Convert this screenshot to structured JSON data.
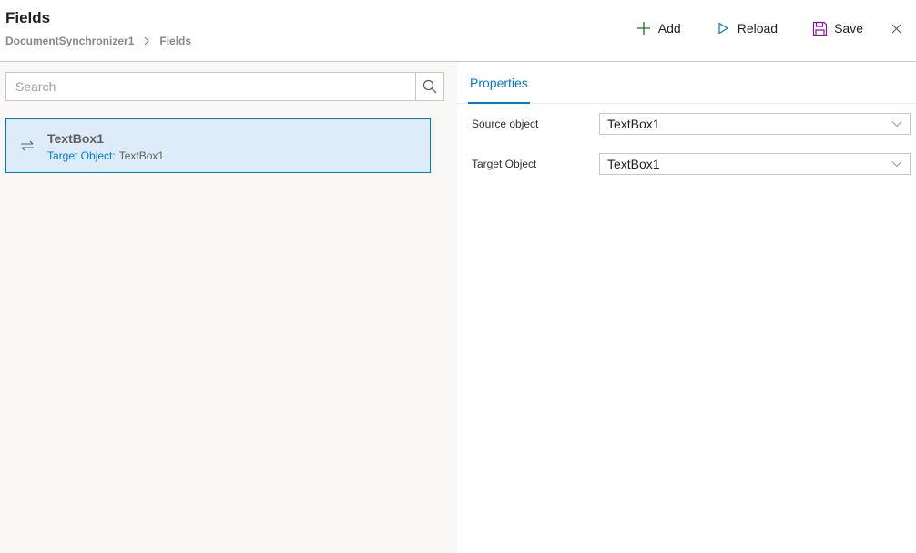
{
  "header": {
    "title": "Fields",
    "breadcrumb": [
      "DocumentSynchronizer1",
      "Fields"
    ]
  },
  "toolbar": {
    "add_label": "Add",
    "reload_label": "Reload",
    "save_label": "Save"
  },
  "search": {
    "placeholder": "Search",
    "value": ""
  },
  "list": {
    "items": [
      {
        "title": "TextBox1",
        "sub_key": "Target Object:",
        "sub_value": "TextBox1",
        "icon": "swap-icon",
        "selected": true
      }
    ]
  },
  "properties": {
    "tab_label": "Properties",
    "rows": [
      {
        "label": "Source object",
        "value": "TextBox1"
      },
      {
        "label": "Target Object",
        "value": "TextBox1"
      }
    ]
  },
  "colors": {
    "accent": "#0078d4",
    "add_icon": "#107c10",
    "save_icon": "#881798",
    "selected_bg": "#deecf9",
    "left_pane_bg": "#f9f8f6"
  }
}
